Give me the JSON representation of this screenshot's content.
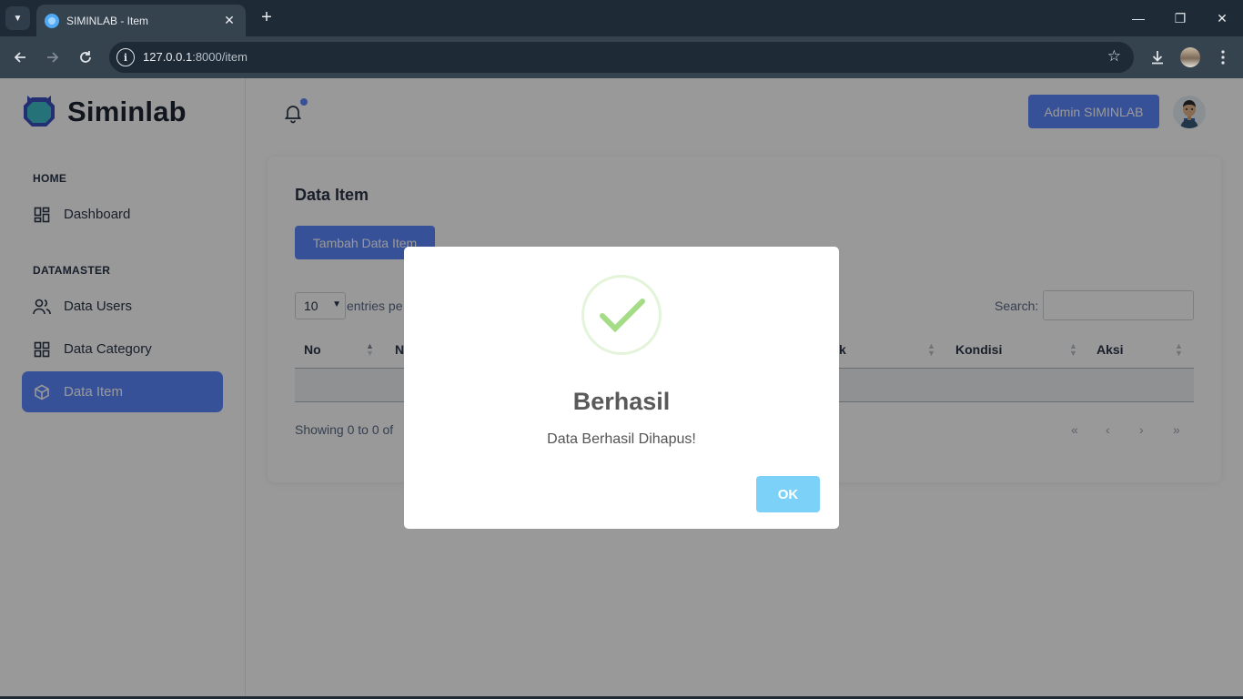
{
  "browser": {
    "tab_title": "SIMINLAB - Item",
    "url_host": "127.0.0.1",
    "url_path": ":8000/item",
    "tab_close": "✕",
    "new_tab": "+",
    "window_minimize": "—",
    "window_restore": "❐",
    "window_close": "✕"
  },
  "app": {
    "brand": "Siminlab",
    "admin_label": "Admin SIMINLAB"
  },
  "sidebar": {
    "sections": [
      {
        "label": "HOME"
      },
      {
        "label": "DATAMASTER"
      }
    ],
    "items": [
      {
        "label": "Dashboard",
        "icon": "layout-dashboard-icon"
      },
      {
        "label": "Data Users",
        "icon": "users-icon"
      },
      {
        "label": "Data Category",
        "icon": "category-grid-icon"
      },
      {
        "label": "Data Item",
        "icon": "box-icon",
        "active": true
      }
    ]
  },
  "main": {
    "title": "Data Item",
    "add_button": "Tambah Data Item",
    "entries_value": "10",
    "entries_text": "entries pe",
    "search_label": "Search:",
    "search_value": "",
    "columns": [
      "No",
      "N",
      "k",
      "Kondisi",
      "Aksi"
    ],
    "showing": "Showing 0 to 0 of",
    "pagination": [
      "«",
      "‹",
      "›",
      "»"
    ]
  },
  "modal": {
    "title": "Berhasil",
    "text": "Data Berhasil Dihapus!",
    "ok_label": "OK",
    "icon": "success-check-icon"
  },
  "colors": {
    "primary": "#5d87ff",
    "ok_button": "#7cd1f9",
    "success_check": "#a5dc86",
    "chrome_dark": "#1e2a36"
  }
}
